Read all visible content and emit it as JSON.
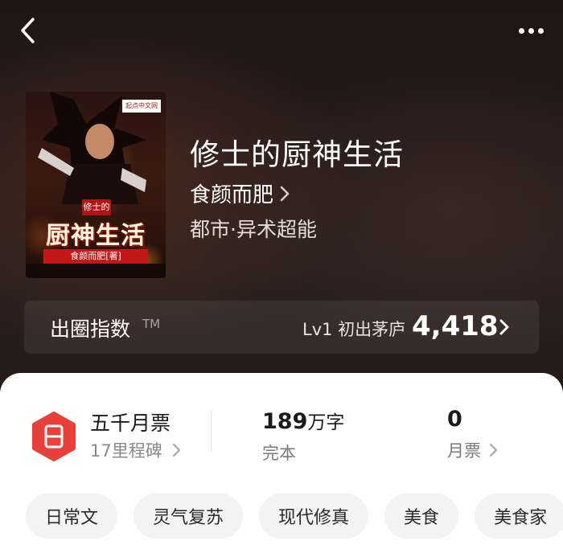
{
  "book": {
    "title": "修士的厨神生活",
    "author": "食颜而肥",
    "genre": "都市·异术超能",
    "cover": {
      "publisher_logo": "起点中文网",
      "small_text": "修士的",
      "big_title": "厨神生活",
      "author_line": "食颜而肥[著]"
    }
  },
  "popularity_index": {
    "title": "出圈指数",
    "tm": "TM",
    "level": "Lv1 初出茅庐",
    "value": "4,418"
  },
  "stats": {
    "milestone_title": "五千月票",
    "milestone_sub": "17里程碑",
    "word_count": "189",
    "word_unit": "万字",
    "status": "完本",
    "monthly_votes": "0",
    "monthly_votes_label": "月票"
  },
  "tags": [
    "日常文",
    "灵气复苏",
    "现代修真",
    "美食",
    "美食家"
  ],
  "colors": {
    "ticket_icon": "#e8413b",
    "panel_bg": "#ffffff",
    "tag_bg": "#f3f3f3"
  },
  "icons": {
    "back": "back-arrow-icon",
    "more": "more-dots-icon",
    "chevron": "chevron-right-icon",
    "ticket": "ticket-icon"
  }
}
